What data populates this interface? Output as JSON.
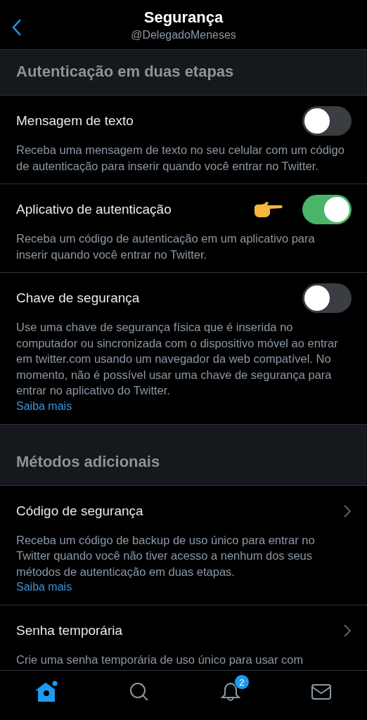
{
  "header": {
    "title": "Segurança",
    "subtitle": "@DelegadoMeneses"
  },
  "sections": [
    {
      "title": "Autenticação em duas etapas",
      "items": [
        {
          "kind": "toggle",
          "title": "Mensagem de texto",
          "on": false,
          "pointer": false,
          "description": "Receba uma mensagem de texto no seu celular com um código de autenticação para inserir quando você entrar no Twitter."
        },
        {
          "kind": "toggle",
          "title": "Aplicativo de autenticação",
          "on": true,
          "pointer": true,
          "description": "Receba um código de autenticação em um aplicativo para inserir quando você entrar no Twitter."
        },
        {
          "kind": "toggle",
          "title": "Chave de segurança",
          "on": false,
          "pointer": false,
          "description": "Use uma chave de segurança física que é inserida no computador ou sincronizada com o dispositivo móvel ao entrar em twitter.com usando um navegador da web compatível. No momento, não é possível usar uma chave de segurança para entrar no aplicativo do Twitter.",
          "link": "Saiba mais"
        }
      ]
    },
    {
      "title": "Métodos adicionais",
      "items": [
        {
          "kind": "link",
          "title": "Código de segurança",
          "description": "Receba um código de backup de uso único para entrar no Twitter quando você não tiver acesso a nenhum dos seus métodos de autenticação em duas etapas.",
          "link": "Saiba mais"
        },
        {
          "kind": "link",
          "title": "Senha temporária",
          "description": "Crie uma senha temporária de uso único para usar com"
        }
      ]
    }
  ],
  "tabs": [
    {
      "kind": "home",
      "selected": true,
      "dot": true
    },
    {
      "kind": "search",
      "selected": false
    },
    {
      "kind": "notifications",
      "selected": false,
      "badge": "2"
    },
    {
      "kind": "messages",
      "selected": false
    }
  ]
}
